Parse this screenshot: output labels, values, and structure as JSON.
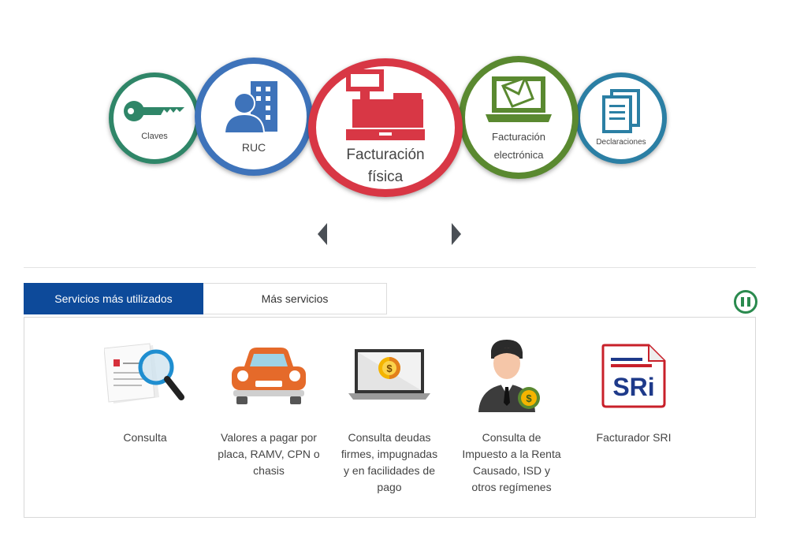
{
  "carousel": {
    "items": [
      {
        "label": "Claves",
        "color": "#2f8668",
        "icon": "key-icon"
      },
      {
        "label": "RUC",
        "color": "#3e73ba",
        "icon": "person-building-icon"
      },
      {
        "label_line1": "Facturación",
        "label_line2": "física",
        "color": "#d83745",
        "icon": "cash-register-icon"
      },
      {
        "label_line1": "Facturación",
        "label_line2": "electrónica",
        "color": "#5a8930",
        "icon": "laptop-envelope-icon"
      },
      {
        "label": "Declaraciones",
        "color": "#2b7fa4",
        "icon": "documents-icon"
      }
    ]
  },
  "tabs": [
    {
      "label": "Servicios más utilizados",
      "active": true
    },
    {
      "label": "Más servicios",
      "active": false
    }
  ],
  "services": [
    {
      "label": "Consulta",
      "icon": "document-magnifier-icon"
    },
    {
      "label": "Valores a pagar por placa, RAMV, CPN o chasis",
      "icon": "car-icon"
    },
    {
      "label": "Consulta deudas firmes, impugnadas y en facilidades de pago",
      "icon": "laptop-coin-icon"
    },
    {
      "label": "Consulta de Impuesto a la Renta Causado, ISD y otros regímenes",
      "icon": "businessman-coin-icon"
    },
    {
      "label": "Facturador SRI",
      "icon": "sri-logo-icon",
      "logo_text": "SRi"
    }
  ],
  "colors": {
    "tab_active": "#0d4a9a",
    "pause": "#2a8a4e",
    "arrows": "#4a4f55"
  }
}
